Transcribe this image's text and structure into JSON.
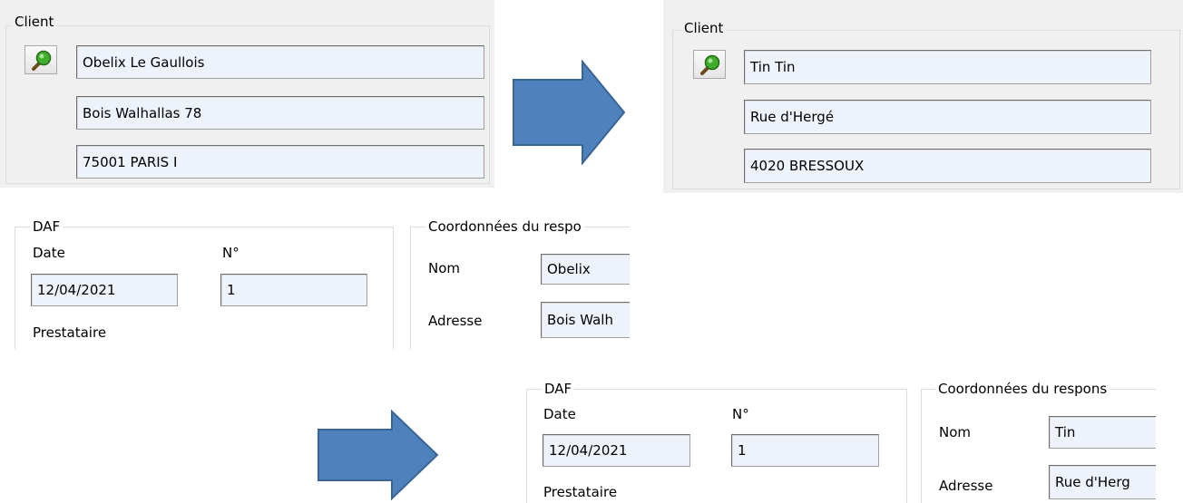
{
  "client_before": {
    "legend": "Client",
    "name": "Obelix Le Gaullois",
    "street": "Bois Walhallas 78",
    "city": "75001 PARIS I",
    "search_icon": "magnifier-icon"
  },
  "client_after": {
    "legend": "Client",
    "name": "Tin Tin",
    "street": "Rue d'Hergé",
    "city": "4020 BRESSOUX",
    "search_icon": "magnifier-icon"
  },
  "daf_before": {
    "legend": "DAF",
    "date_label": "Date",
    "date_value": "12/04/2021",
    "num_label": "N°",
    "num_value": "1",
    "prestataire_label": "Prestataire",
    "coord_legend": "Coordonnées du respo",
    "nom_label": "Nom",
    "nom_value": "Obelix",
    "adresse_label": "Adresse",
    "adresse_value": "Bois Walh"
  },
  "daf_after": {
    "legend": "DAF",
    "date_label": "Date",
    "date_value": "12/04/2021",
    "num_label": "N°",
    "num_value": "1",
    "prestataire_label": "Prestataire",
    "coord_legend": "Coordonnées du respons",
    "nom_label": "Nom",
    "nom_value": "Tin",
    "adresse_label": "Adresse",
    "adresse_value": "Rue d'Herg"
  },
  "colors": {
    "arrow_fill": "#4f81bd",
    "arrow_stroke": "#3a6593",
    "field_bg": "#eef3fb",
    "panel_bg": "#f0f0f0"
  }
}
